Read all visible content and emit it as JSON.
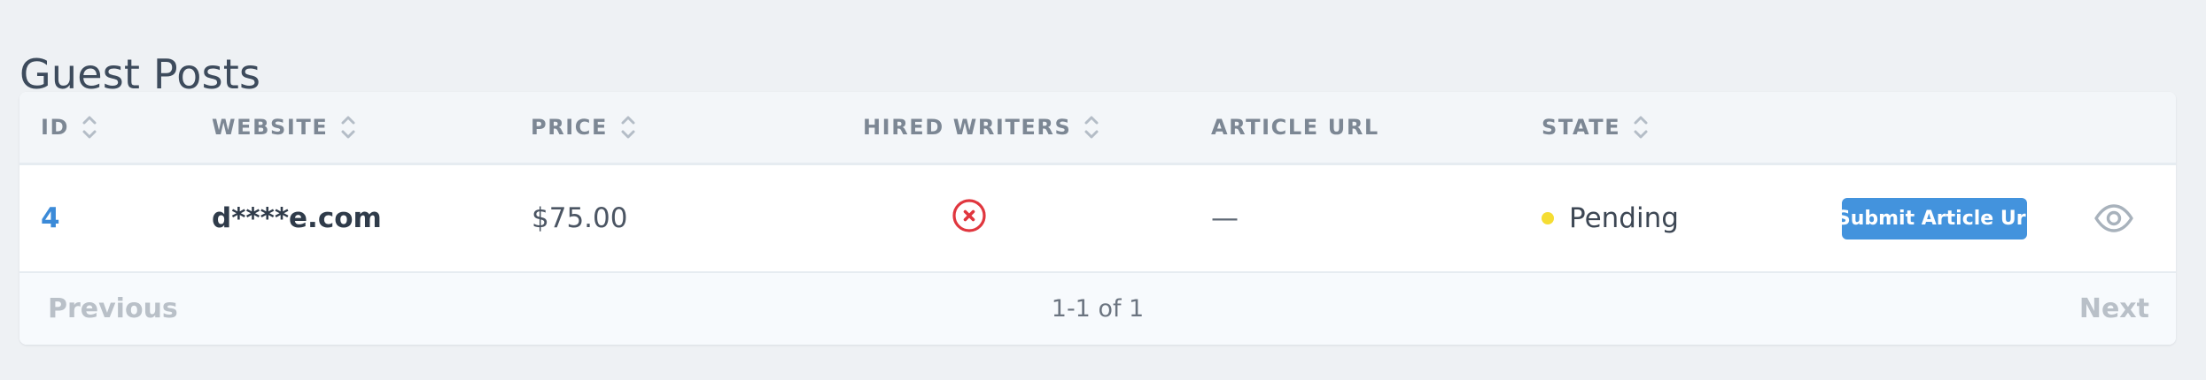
{
  "page": {
    "title": "Guest Posts"
  },
  "table": {
    "columns": [
      {
        "label": "ID",
        "sortable": true
      },
      {
        "label": "WEBSITE",
        "sortable": true
      },
      {
        "label": "PRICE",
        "sortable": true
      },
      {
        "label": "HIRED WRITERS",
        "sortable": true
      },
      {
        "label": "ARTICLE URL",
        "sortable": false
      },
      {
        "label": "STATE",
        "sortable": true
      }
    ],
    "rows": [
      {
        "id": "4",
        "website": "d****e.com",
        "price": "$75.00",
        "hired_writers_icon": "x-circle-icon",
        "article_url": "—",
        "state": "Pending",
        "state_color": "#f5dd33",
        "action_label": "Submit Article Url",
        "view_icon": "eye-icon"
      }
    ]
  },
  "pagination": {
    "previous_label": "Previous",
    "info": "1-1 of 1",
    "next_label": "Next"
  },
  "colors": {
    "accent": "#3b8ad8",
    "button": "#4393dd",
    "error": "#e0363e",
    "icon_muted": "#a8b2bc"
  }
}
